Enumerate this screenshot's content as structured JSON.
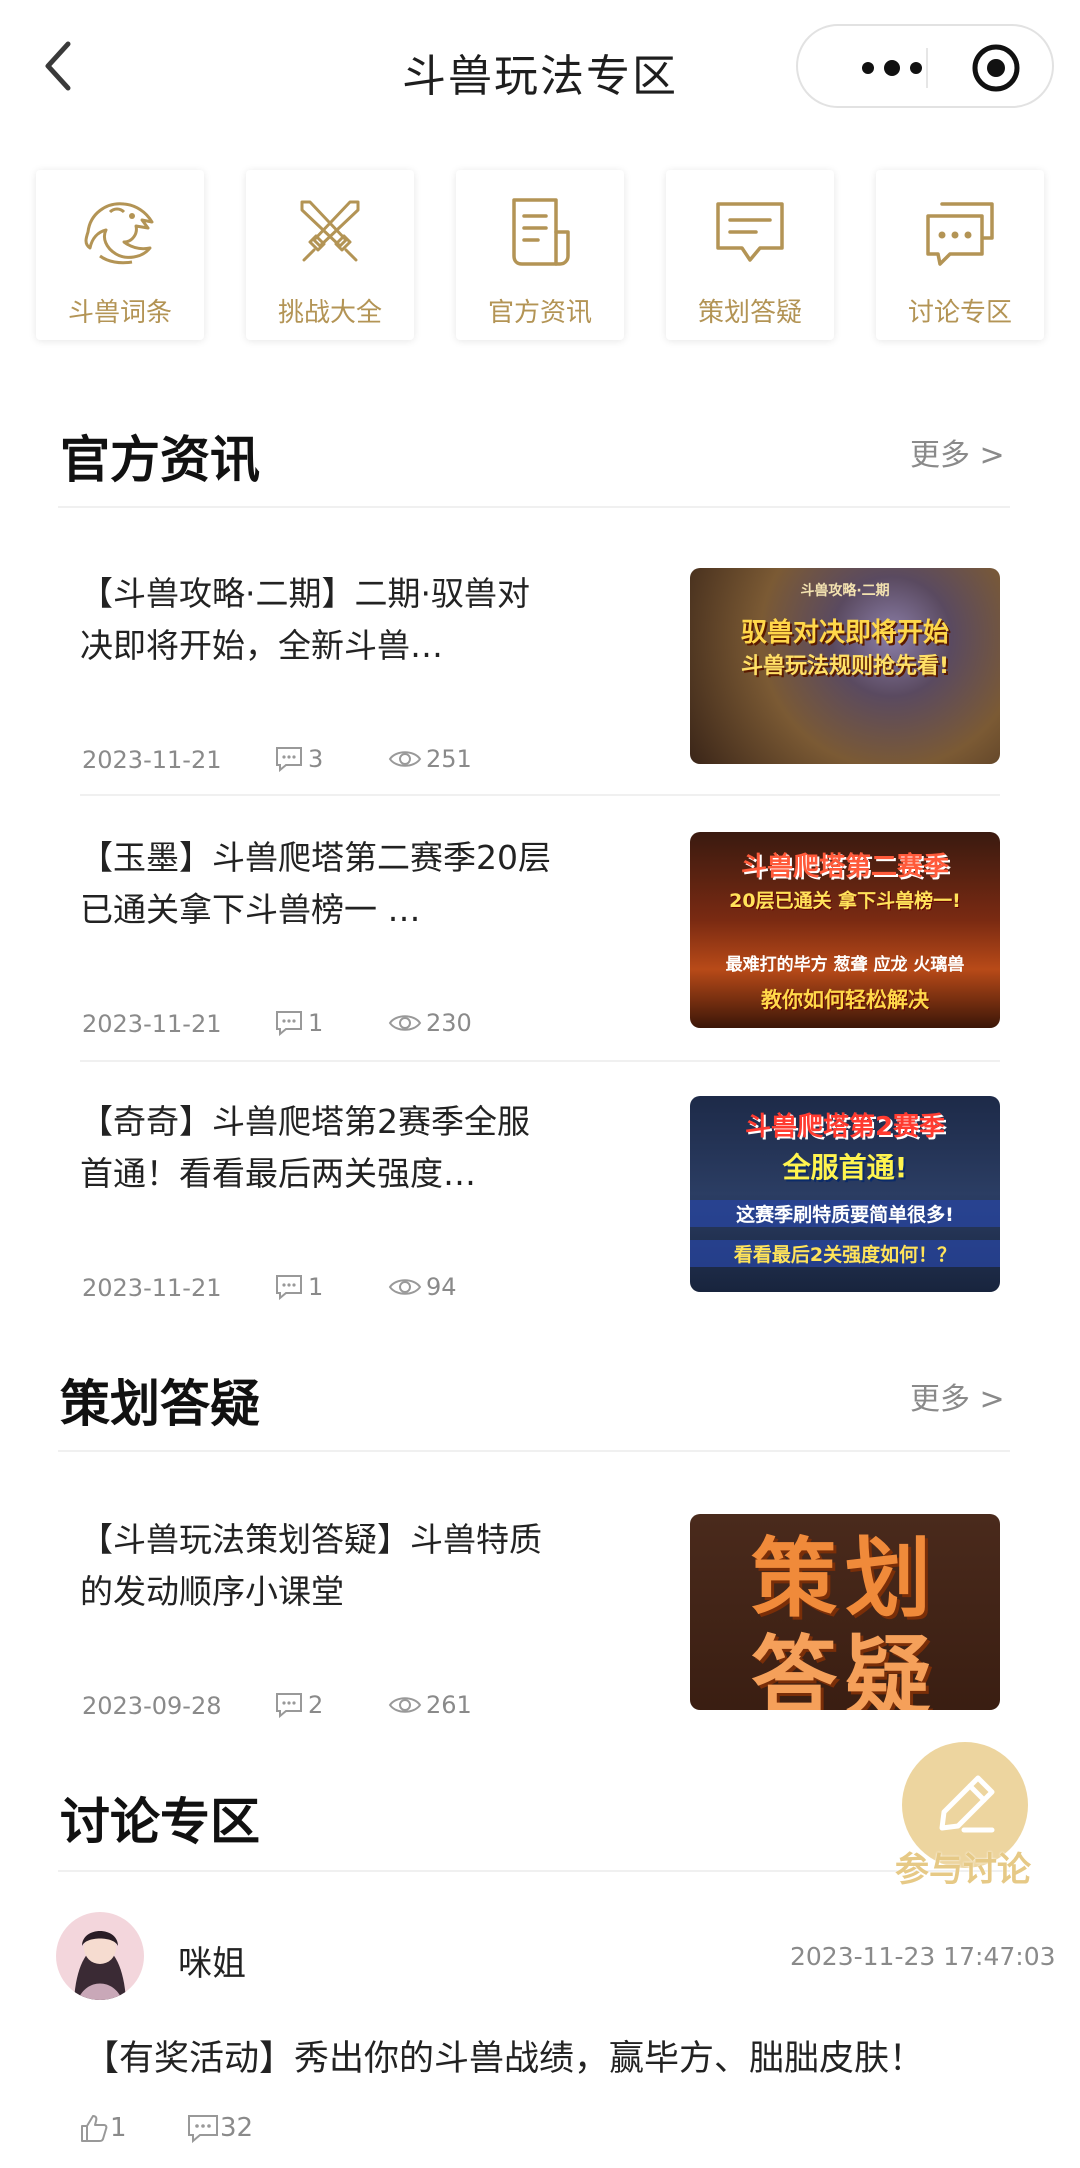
{
  "header": {
    "title": "斗兽玩法专区"
  },
  "quick_entries": [
    {
      "label": "斗兽词条",
      "icon": "dragon-icon"
    },
    {
      "label": "挑战大全",
      "icon": "crossed-swords-icon"
    },
    {
      "label": "官方资讯",
      "icon": "document-icon"
    },
    {
      "label": "策划答疑",
      "icon": "chat-bubble-icon"
    },
    {
      "label": "讨论专区",
      "icon": "discussion-icon"
    }
  ],
  "news": {
    "title": "官方资讯",
    "more": "更多 >",
    "articles": [
      {
        "title": "【斗兽攻略·二期】二期·驭兽对决即将开始，全新斗兽…",
        "date": "2023-11-21",
        "comments": "3",
        "views": "251",
        "thumb_lines": [
          "驭兽对决即将开始",
          "斗兽玩法规则抢先看!",
          "斗兽攻略·二期"
        ]
      },
      {
        "title": "【玉墨】斗兽爬塔第二赛季20层已通关拿下斗兽榜一 …",
        "date": "2023-11-21",
        "comments": "1",
        "views": "230",
        "thumb_lines": [
          "斗兽爬塔第二赛季",
          "20层已通关 拿下斗兽榜一!",
          "最难打的毕方 葱聋 应龙 火璃兽",
          "教你如何轻松解决"
        ]
      },
      {
        "title": "【奇奇】斗兽爬塔第2赛季全服首通！看看最后两关强度…",
        "date": "2023-11-21",
        "comments": "1",
        "views": "94",
        "thumb_lines": [
          "斗兽爬塔第2赛季",
          "全服首通!",
          "这赛季刷特质要简单很多!",
          "看看最后2关强度如何！？"
        ]
      }
    ]
  },
  "qa": {
    "title": "策划答疑",
    "more": "更多 >",
    "articles": [
      {
        "title": "【斗兽玩法策划答疑】斗兽特质的发动顺序小课堂",
        "date": "2023-09-28",
        "comments": "2",
        "views": "261",
        "thumb_lines": [
          "策划",
          "答疑"
        ]
      }
    ]
  },
  "discussion": {
    "title": "讨论专区",
    "fab_label": "参与讨论",
    "post": {
      "user": "咪姐",
      "time": "2023-11-23 17:47:03",
      "text": "【有奖活动】秀出你的斗兽战绩，赢毕方、朏朏皮肤！",
      "likes": "1",
      "comments": "32"
    }
  },
  "colors": {
    "accent_gold": "#b39455",
    "gray_text": "#8a8a8a"
  }
}
